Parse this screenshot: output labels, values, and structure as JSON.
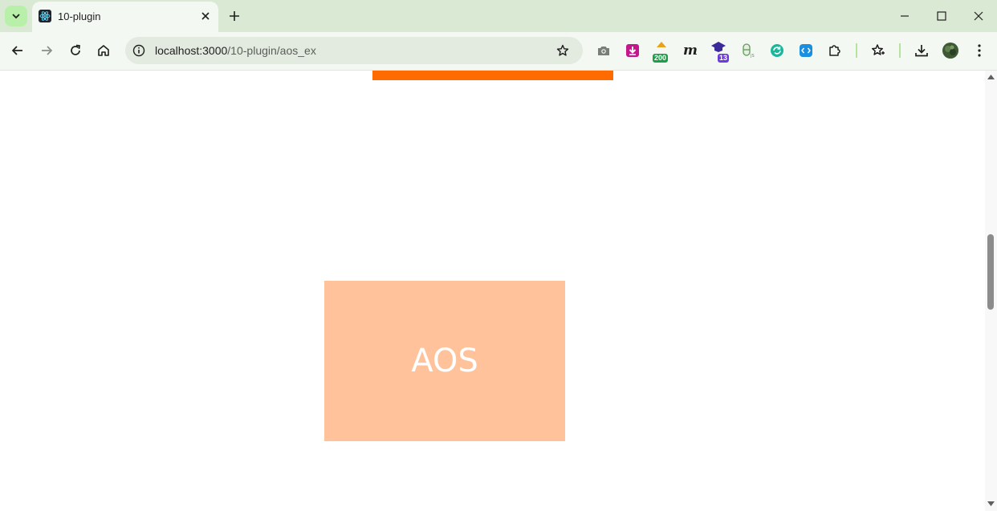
{
  "browser": {
    "tab": {
      "title": "10-plugin",
      "favicon": "react-logo-icon"
    },
    "window_controls": [
      "minimize",
      "maximize",
      "close"
    ]
  },
  "toolbar": {
    "url_host": "localhost:3000",
    "url_path": "/10-plugin/aos_ex",
    "extensions": [
      {
        "name": "camera-icon"
      },
      {
        "name": "download-arrow-extension-icon"
      },
      {
        "name": "counter-extension-icon",
        "badge": "200"
      },
      {
        "name": "m-extension-icon"
      },
      {
        "name": "graduation-cap-extension-icon",
        "badge": "13"
      },
      {
        "name": "nodejs-extension-icon"
      },
      {
        "name": "refresh-circle-extension-icon"
      },
      {
        "name": "code-square-extension-icon"
      },
      {
        "name": "puzzle-extensions-icon"
      }
    ]
  },
  "page": {
    "aos_label": "AOS",
    "colors": {
      "orange_bar": "#ff6b00",
      "aos_box": "#ffc29a"
    }
  }
}
